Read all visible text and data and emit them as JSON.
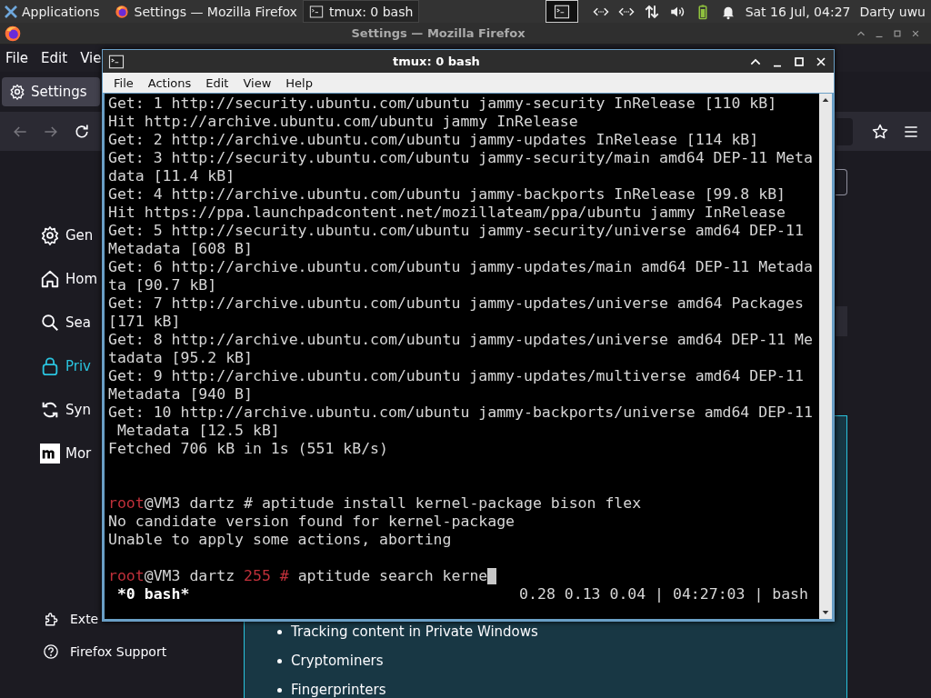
{
  "top_panel": {
    "apps_label": "Applications",
    "tasks": [
      {
        "label": "Settings — Mozilla Firefox",
        "selected": false
      },
      {
        "label": "tmux: 0 bash",
        "selected": true
      }
    ],
    "clock": "Sat 16 Jul, 04:27",
    "user": "Darty uwu"
  },
  "firefox": {
    "title": "Settings — Mozilla Firefox",
    "menu": [
      "File",
      "Edit",
      "Vie"
    ],
    "tab": {
      "label": "Settings",
      "selected": true
    },
    "sidebar": [
      {
        "label": "Gen",
        "selected": false
      },
      {
        "label": "Hom",
        "selected": false
      },
      {
        "label": "Sea",
        "selected": false
      },
      {
        "label": "Priv",
        "selected": true
      },
      {
        "label": "Syn",
        "selected": false
      },
      {
        "label": "Mor",
        "selected": false
      }
    ],
    "footer_links": [
      "Exte",
      "Firefox Support"
    ],
    "list": [
      "Tracking content in Private Windows",
      "Cryptominers",
      "Fingerprinters"
    ]
  },
  "terminal": {
    "title": "tmux: 0 bash",
    "menu": [
      "File",
      "Actions",
      "Edit",
      "View",
      "Help"
    ],
    "lines": [
      {
        "kind": "text",
        "text": "Get: 1 http://security.ubuntu.com/ubuntu jammy-security InRelease [110 kB]"
      },
      {
        "kind": "text",
        "text": "Hit http://archive.ubuntu.com/ubuntu jammy InRelease"
      },
      {
        "kind": "text",
        "text": "Get: 2 http://archive.ubuntu.com/ubuntu jammy-updates InRelease [114 kB]"
      },
      {
        "kind": "text",
        "text": "Get: 3 http://security.ubuntu.com/ubuntu jammy-security/main amd64 DEP-11 Meta"
      },
      {
        "kind": "text",
        "text": "data [11.4 kB]"
      },
      {
        "kind": "text",
        "text": "Get: 4 http://archive.ubuntu.com/ubuntu jammy-backports InRelease [99.8 kB]"
      },
      {
        "kind": "text",
        "text": "Hit https://ppa.launchpadcontent.net/mozillateam/ppa/ubuntu jammy InRelease"
      },
      {
        "kind": "text",
        "text": "Get: 5 http://security.ubuntu.com/ubuntu jammy-security/universe amd64 DEP-11"
      },
      {
        "kind": "text",
        "text": "Metadata [608 B]"
      },
      {
        "kind": "text",
        "text": "Get: 6 http://archive.ubuntu.com/ubuntu jammy-updates/main amd64 DEP-11 Metada"
      },
      {
        "kind": "text",
        "text": "ta [90.7 kB]"
      },
      {
        "kind": "text",
        "text": "Get: 7 http://archive.ubuntu.com/ubuntu jammy-updates/universe amd64 Packages"
      },
      {
        "kind": "text",
        "text": "[171 kB]"
      },
      {
        "kind": "text",
        "text": "Get: 8 http://archive.ubuntu.com/ubuntu jammy-updates/universe amd64 DEP-11 Me"
      },
      {
        "kind": "text",
        "text": "tadata [95.2 kB]"
      },
      {
        "kind": "text",
        "text": "Get: 9 http://archive.ubuntu.com/ubuntu jammy-updates/multiverse amd64 DEP-11"
      },
      {
        "kind": "text",
        "text": "Metadata [940 B]"
      },
      {
        "kind": "text",
        "text": "Get: 10 http://archive.ubuntu.com/ubuntu jammy-backports/universe amd64 DEP-11"
      },
      {
        "kind": "text",
        "text": " Metadata [12.5 kB]"
      },
      {
        "kind": "text",
        "text": "Fetched 706 kB in 1s (551 kB/s)"
      },
      {
        "kind": "blank"
      },
      {
        "kind": "blank"
      },
      {
        "kind": "prompt",
        "user": "root",
        "path": "@VM3 dartz",
        "symbol": "#",
        "command": "aptitude install kernel-package bison flex",
        "cursor": false
      },
      {
        "kind": "text",
        "text": "No candidate version found for kernel-package"
      },
      {
        "kind": "text",
        "text": "Unable to apply some actions, aborting"
      },
      {
        "kind": "blank"
      },
      {
        "kind": "prompt",
        "user": "root",
        "path": "@VM3 dartz",
        "status": "255",
        "symbol": "#",
        "command": "aptitude search kerne",
        "cursor": true
      }
    ],
    "status": {
      "window": "*0 bash*",
      "info": "0.28 0.13 0.04 | 04:27:03 | bash"
    }
  }
}
